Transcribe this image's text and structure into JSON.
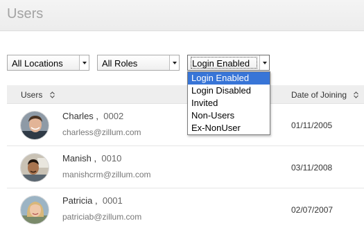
{
  "header": {
    "title": "Users"
  },
  "filters": {
    "location": {
      "value": "All Locations"
    },
    "role": {
      "value": "All Roles"
    },
    "status": {
      "value": "Login Enabled",
      "options": [
        "Login Enabled",
        "Login Disabled",
        "Invited",
        "Non-Users",
        "Ex-NonUser"
      ],
      "selected_index": 0
    }
  },
  "table": {
    "columns": {
      "users": "Users",
      "date_of_joining": "Date of Joining"
    },
    "rows": [
      {
        "name": "Charles",
        "separator": ",",
        "id": "0002",
        "email": "charless@zillum.com",
        "date": "01/11/2005"
      },
      {
        "name": "Manish",
        "separator": ",",
        "id": "0010",
        "email": "manishcrm@zillum.com",
        "date": "03/11/2008"
      },
      {
        "name": "Patricia",
        "separator": ",",
        "id": "0001",
        "email": "patriciab@zillum.com",
        "date": "02/07/2007"
      }
    ]
  },
  "colors": {
    "selected_option": "#3875d7",
    "header_bg": "#eeeeee",
    "title": "#a3a3a3"
  }
}
